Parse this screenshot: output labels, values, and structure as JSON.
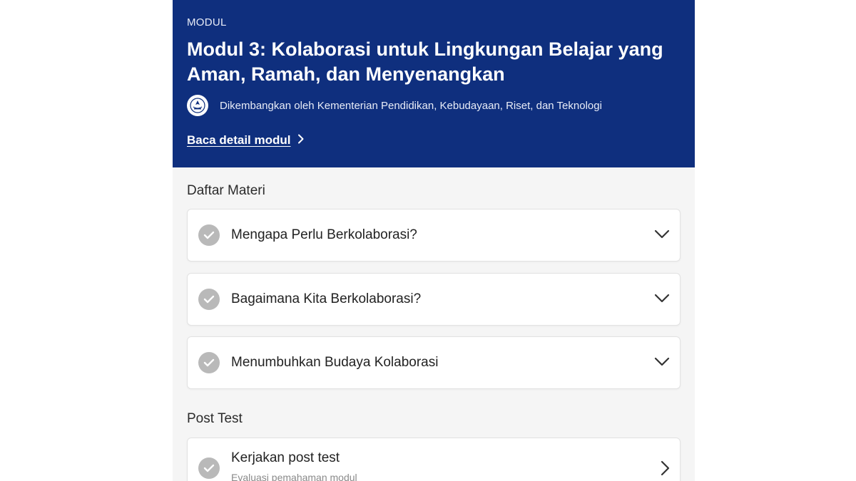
{
  "hero": {
    "kicker": "MODUL",
    "title_line1": "Modul 3: Kolaborasi untuk Lingkungan Belajar yang",
    "title_line2": "Aman, Ramah, dan Menyenangkan",
    "developer": "Dikembangkan oleh Kementerian Pendidikan, Kebudayaan, Riset, dan Teknologi",
    "detail_link": "Baca detail modul"
  },
  "materials": {
    "heading": "Daftar Materi",
    "items": [
      {
        "title": "Mengapa Perlu Berkolaborasi?",
        "icon": "chevron-down-icon"
      },
      {
        "title": "Bagaimana Kita Berkolaborasi?",
        "icon": "chevron-down-icon"
      },
      {
        "title": "Menumbuhkan Budaya Kolaborasi",
        "icon": "chevron-down-icon"
      }
    ]
  },
  "post_test": {
    "heading": "Post Test",
    "title": "Kerjakan post test",
    "subtitle": "Evaluasi pemahaman modul",
    "icon": "chevron-right-icon"
  },
  "colors": {
    "hero_background": "#0f2f7e",
    "check_circle": "#b9b9b9",
    "page_background": "#f5f5f5"
  }
}
